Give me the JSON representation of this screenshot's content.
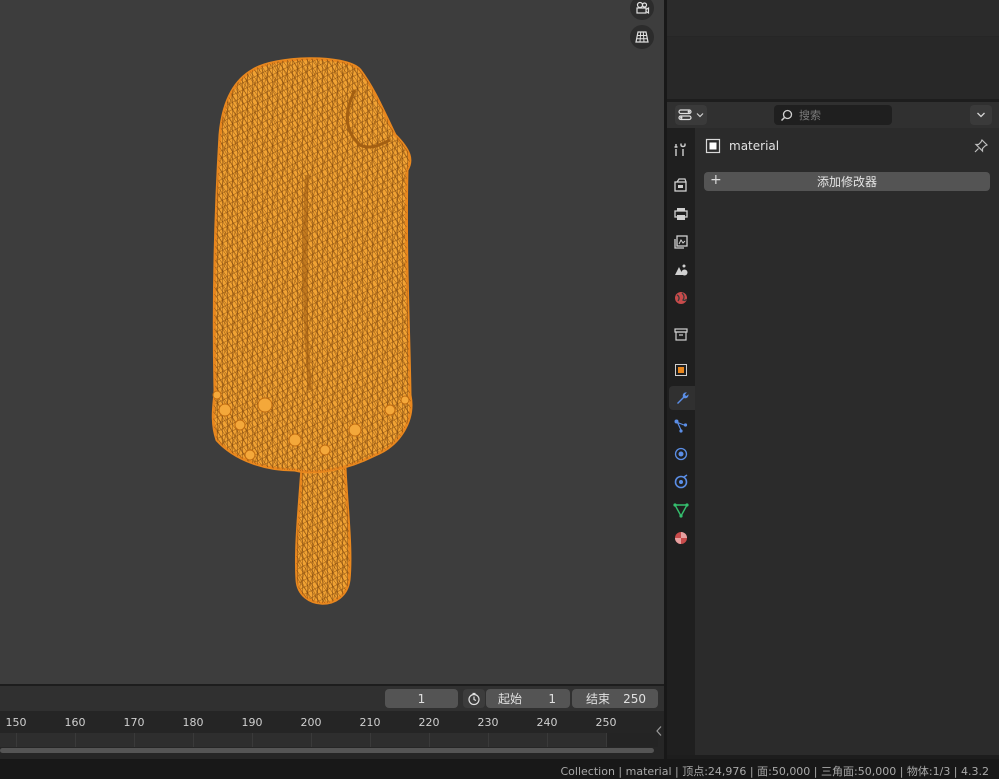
{
  "viewport": {
    "camera_button_icon": "camera-view-icon",
    "grid_button_icon": "grid-view-icon",
    "model": "popsicle-wireframe"
  },
  "properties": {
    "editor_type_icon": "properties-editor-icon",
    "search_placeholder": "搜索",
    "object_name": "material",
    "add_modifier_label": "添加修改器",
    "tabs": [
      {
        "name": "tool",
        "icon": "tool-icon",
        "active": false
      },
      {
        "name": "render",
        "icon": "render-icon",
        "active": false
      },
      {
        "name": "output",
        "icon": "output-icon",
        "active": false
      },
      {
        "name": "view-layer",
        "icon": "view-layer-icon",
        "active": false
      },
      {
        "name": "scene",
        "icon": "scene-icon",
        "active": false
      },
      {
        "name": "world",
        "icon": "world-icon",
        "active": false
      },
      {
        "name": "collection",
        "icon": "collection-icon",
        "active": false
      },
      {
        "name": "object",
        "icon": "object-icon",
        "active": false
      },
      {
        "name": "modifiers",
        "icon": "wrench-icon",
        "active": true
      },
      {
        "name": "particles",
        "icon": "particles-icon",
        "active": false
      },
      {
        "name": "physics",
        "icon": "physics-icon",
        "active": false
      },
      {
        "name": "constraints",
        "icon": "constraints-icon",
        "active": false
      },
      {
        "name": "data",
        "icon": "mesh-data-icon",
        "active": false
      },
      {
        "name": "material",
        "icon": "material-icon",
        "active": false
      }
    ]
  },
  "timeline": {
    "current_frame": "1",
    "start_label": "起始",
    "start_value": "1",
    "end_label": "结束",
    "end_value": "250",
    "ticks": [
      "150",
      "160",
      "170",
      "180",
      "190",
      "200",
      "210",
      "220",
      "230",
      "240",
      "250"
    ]
  },
  "status": {
    "text": "Collection | material | 顶点:24,976 | 面:50,000 | 三角面:50,000 | 物体:1/3 | 4.3.2"
  },
  "colors": {
    "accent_orange": "#e8871e",
    "viewport_bg": "#3d3d3d",
    "panel_bg": "#2b2b2b",
    "active_tab_blue": "#5b8ee6"
  }
}
